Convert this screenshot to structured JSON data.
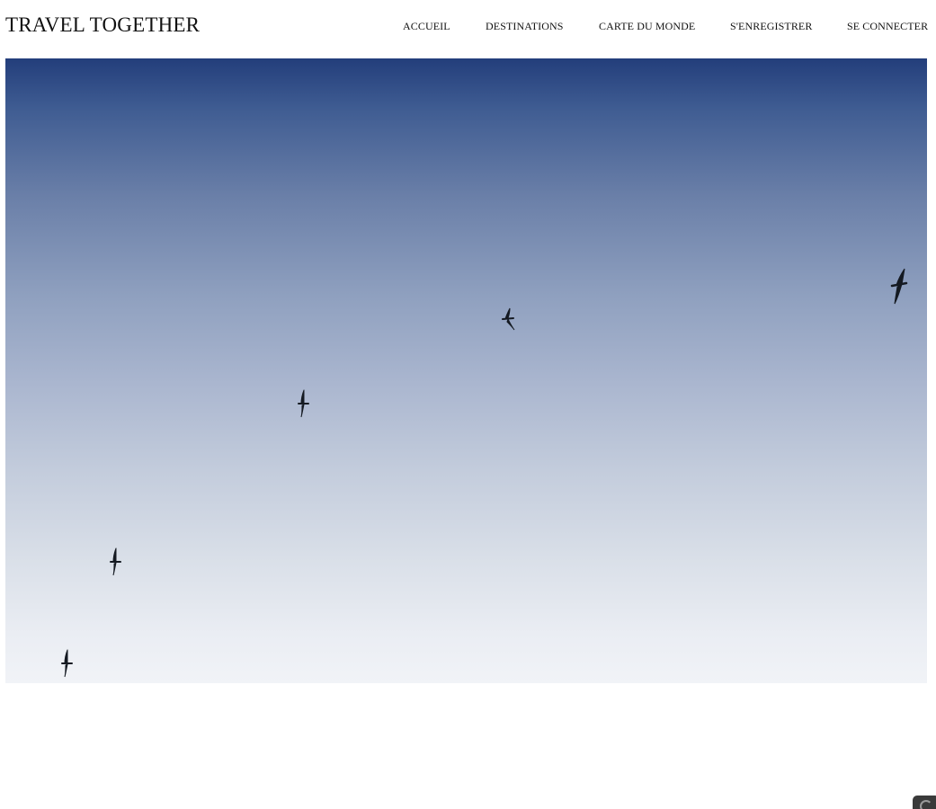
{
  "header": {
    "brand": "TRAVEL TOGETHER",
    "nav": {
      "home": "ACCUEIL",
      "destinations": "DESTINATIONS",
      "world_map": "CARTE DU MONDE",
      "register": "S'ENREGISTRER",
      "login": "SE CONNECTER"
    }
  },
  "hero": {
    "image_subject": "birds-in-sky",
    "bird_count": 5,
    "colors": {
      "sky_top": "#233e7b",
      "sky_bottom": "#f1f3f7",
      "bird": "#151a22"
    }
  },
  "corner_widget": {
    "icon": "chat-bubble-icon"
  }
}
